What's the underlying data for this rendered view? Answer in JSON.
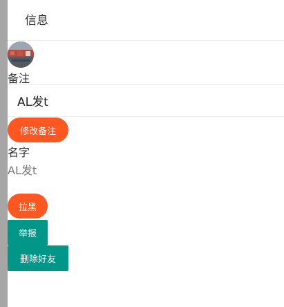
{
  "header": {
    "title": "信息"
  },
  "profile": {
    "remark_label": "备注",
    "remark_value": "AL发t",
    "edit_remark_button": "修改备注",
    "name_label": "名字",
    "name_value": "AL发t"
  },
  "actions": {
    "block_button": "拉黑",
    "report_button": "举报",
    "delete_friend_button": "删除好友"
  },
  "colors": {
    "accent_orange": "#ff5722",
    "accent_teal": "#009688",
    "left_strip": "#a6a6a6"
  }
}
